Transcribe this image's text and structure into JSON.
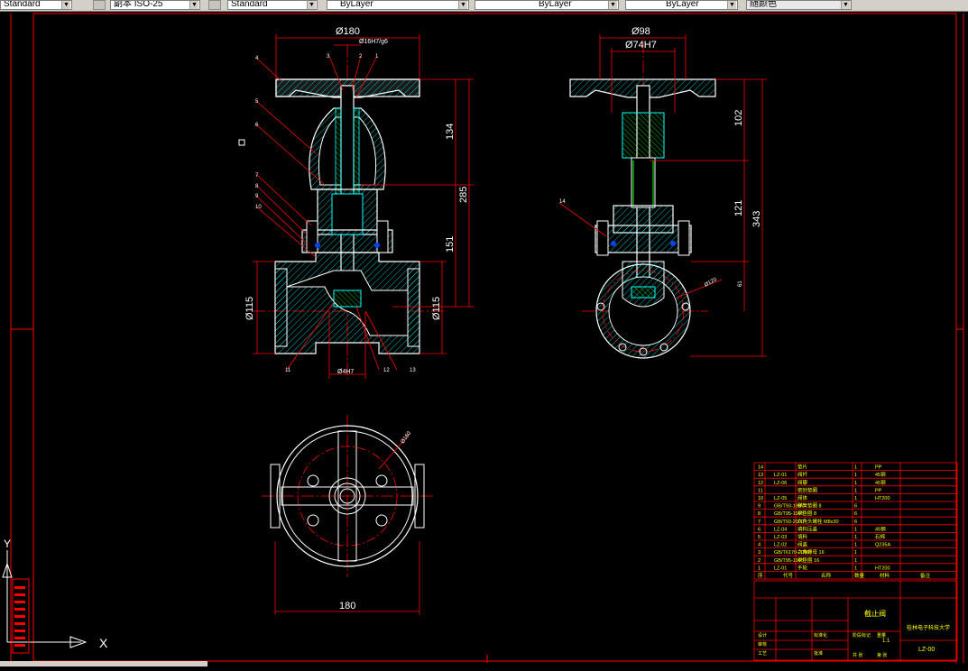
{
  "toolbar": {
    "text_style": "Standard",
    "dim_style": "副本 ISO-25",
    "table_style": "Standard",
    "layer": "ByLayer",
    "linetype": "ByLayer",
    "lineweight": "ByLayer",
    "plot_style": "随颜色"
  },
  "drawing": {
    "front_view": {
      "dia_top": "Ø180",
      "fit_stem": "Ø16H7/g6",
      "len_134": "134",
      "len_285": "285",
      "len_151": "151",
      "dia_left": "Ø115",
      "dia_right": "Ø115",
      "fit_bottom": "Ø4H7",
      "callouts_top": [
        "3",
        "2",
        "1"
      ],
      "callouts_left": [
        "4",
        "5",
        "6",
        "7",
        "8",
        "9",
        "10"
      ],
      "callout_bottom": [
        "11",
        "12",
        "13"
      ]
    },
    "side_view": {
      "dia_98": "Ø98",
      "dia_74": "Ø74H7",
      "len_102": "102",
      "len_121": "121",
      "len_343": "343",
      "len_61": "61",
      "dia_circle": "Ø120",
      "callout": "14"
    },
    "top_view": {
      "width": "180",
      "dia_label": "Ø160"
    }
  },
  "bom": {
    "rows": [
      {
        "no": "14",
        "code": "",
        "name": "垫片",
        "qty": "1",
        "mat": "PP"
      },
      {
        "no": "13",
        "code": "LZ-01",
        "name": "阀杆",
        "qty": "1",
        "mat": "45钢"
      },
      {
        "no": "12",
        "code": "LZ-06",
        "name": "阀瓣",
        "qty": "1",
        "mat": "45钢"
      },
      {
        "no": "11",
        "code": "",
        "name": "密封垫圈",
        "qty": "1",
        "mat": "PP"
      },
      {
        "no": "10",
        "code": "LZ-05",
        "name": "阀体",
        "qty": "1",
        "mat": "HT200"
      },
      {
        "no": "9",
        "code": "GB/T93-1987",
        "name": "弹簧垫圈 8",
        "qty": "6",
        "mat": ""
      },
      {
        "no": "8",
        "code": "GB/T95-1985",
        "name": "平垫圈 8",
        "qty": "6",
        "mat": ""
      },
      {
        "no": "7",
        "code": "GB/T93-2000",
        "name": "六角头螺栓 M8x30",
        "qty": "6",
        "mat": ""
      },
      {
        "no": "6",
        "code": "LZ-04",
        "name": "填料压盖",
        "qty": "1",
        "mat": "45钢"
      },
      {
        "no": "5",
        "code": "LZ-03",
        "name": "填料",
        "qty": "1",
        "mat": "石棉"
      },
      {
        "no": "4",
        "code": "LZ-02",
        "name": "阀盖",
        "qty": "1",
        "mat": "Q235A"
      },
      {
        "no": "3",
        "code": "GB/T6170-2000",
        "name": "六角螺母 16",
        "qty": "1",
        "mat": ""
      },
      {
        "no": "2",
        "code": "GB/T95-1985",
        "name": "平垫圈 16",
        "qty": "1",
        "mat": ""
      },
      {
        "no": "1",
        "code": "LZ-01",
        "name": "手轮",
        "qty": "1",
        "mat": "HT200"
      }
    ],
    "header": {
      "no": "序",
      "code": "代号",
      "name": "名称",
      "qty": "数量",
      "mat": "材料",
      "note": "备注"
    }
  },
  "title_block": {
    "title": "截止阀",
    "company": "桂林电子科技大学",
    "drawing_no": "LZ-00",
    "labels": [
      "标记",
      "处数",
      "分区",
      "更改文件号",
      "签名",
      "年月日",
      "设计",
      "标准化",
      "审核",
      "工艺",
      "批准",
      "阶段标记",
      "重量",
      "比例",
      "共 张",
      "第 张"
    ],
    "scale": "1:1"
  },
  "ucs": {
    "x": "X",
    "y": "Y"
  }
}
